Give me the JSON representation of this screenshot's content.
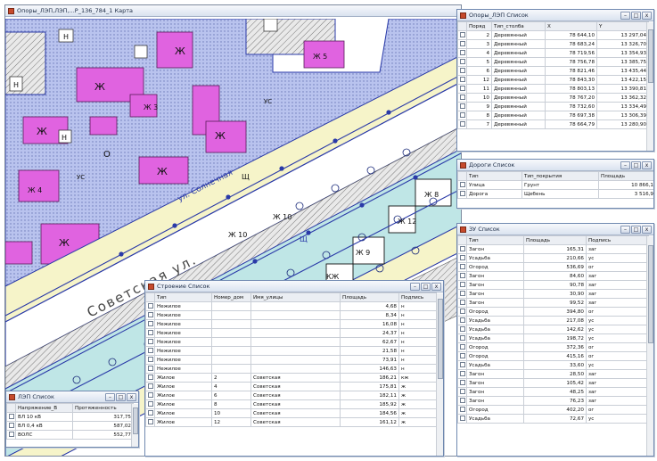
{
  "colors": {
    "building": "#e063e0",
    "parcel": "#b9c3ee",
    "green_strip": "#bfe6e6",
    "road": "#ffffff",
    "sidewalk": "#f6f4c9",
    "line": "#2a3aa8"
  },
  "map_window": {
    "title": "Опоры_ЛЭП,ЛЭП,...Р_136_784_1 Карта",
    "labels": {
      "street1": "ул. Солнечная",
      "street2": "Советская ул.",
      "sh1": "Щ",
      "sh2": "Щ",
      "g1": "Ж",
      "g2": "Ж",
      "g3": "Ж",
      "g4": "Ж",
      "g5": "Ж",
      "g6": "Ж",
      "n1": "Н",
      "n2": "Н",
      "n3": "Н",
      "us1": "УС",
      "us2": "УС",
      "z1": "Ж 9",
      "z2": "Ж 10",
      "z3": "Ж 10",
      "z4": "Ж 12",
      "z5": "Ж 8",
      "z6": "КЖ",
      "z7": "Ж 5",
      "z8": "Ж 3",
      "z9": "Ж 4",
      "g": "О"
    }
  },
  "poles_window": {
    "title": "Опоры_ЛЭП Список",
    "columns": [
      "Поряд",
      "Тип_столба",
      "X",
      "Y"
    ],
    "rows": [
      [
        "2",
        "Деревянный",
        "78 644,10",
        "13 297,04"
      ],
      [
        "3",
        "Деревянный",
        "78 683,24",
        "13 326,70"
      ],
      [
        "4",
        "Деревянный",
        "78 719,56",
        "13 354,93"
      ],
      [
        "5",
        "Деревянный",
        "78 756,78",
        "13 385,75"
      ],
      [
        "6",
        "Деревянный",
        "78 821,46",
        "13 435,44"
      ],
      [
        "12",
        "Деревянный",
        "78 843,30",
        "13 422,15"
      ],
      [
        "11",
        "Деревянный",
        "78 803,13",
        "13 390,81"
      ],
      [
        "10",
        "Деревянный",
        "78 767,20",
        "13 362,32"
      ],
      [
        "9",
        "Деревянный",
        "78 732,60",
        "13 334,49"
      ],
      [
        "8",
        "Деревянный",
        "78 697,38",
        "13 306,39"
      ],
      [
        "7",
        "Деревянный",
        "78 664,79",
        "13 280,90"
      ]
    ]
  },
  "roads_window": {
    "title": "Дороги Список",
    "columns": [
      "Тип",
      "Тип_покрытия",
      "Площадь"
    ],
    "rows": [
      [
        "Улица",
        "Грунт",
        "10 866,1"
      ],
      [
        "Дорога",
        "Щебень",
        "3 516,9"
      ]
    ]
  },
  "zu_window": {
    "title": "ЗУ Список",
    "columns": [
      "Тип",
      "Площадь",
      "Подпись"
    ],
    "rows": [
      [
        "Загон",
        "165,31",
        "заг"
      ],
      [
        "Усадьба",
        "210,66",
        "ус"
      ],
      [
        "Огород",
        "536,69",
        "ог"
      ],
      [
        "Загон",
        "84,60",
        "заг"
      ],
      [
        "Загон",
        "90,78",
        "заг"
      ],
      [
        "Загон",
        "30,90",
        "заг"
      ],
      [
        "Загон",
        "99,52",
        "заг"
      ],
      [
        "Огород",
        "394,80",
        "ог"
      ],
      [
        "Усадьба",
        "217,08",
        "ус"
      ],
      [
        "Усадьба",
        "142,62",
        "ус"
      ],
      [
        "Усадьба",
        "198,72",
        "ус"
      ],
      [
        "Огород",
        "372,36",
        "ог"
      ],
      [
        "Огород",
        "415,16",
        "ог"
      ],
      [
        "Усадьба",
        "33,60",
        "ус"
      ],
      [
        "Загон",
        "28,50",
        "заг"
      ],
      [
        "Загон",
        "105,42",
        "заг"
      ],
      [
        "Загон",
        "48,25",
        "заг"
      ],
      [
        "Загон",
        "76,23",
        "заг"
      ],
      [
        "Огород",
        "402,20",
        "ог"
      ],
      [
        "Усадьба",
        "72,67",
        "ус"
      ]
    ]
  },
  "buildings_window": {
    "title": "Строение Список",
    "columns": [
      "Тип",
      "Номер_дом",
      "Имя_улицы",
      "Площадь",
      "Подпись"
    ],
    "rows": [
      [
        "Нежилое",
        "",
        "",
        "4,68",
        "н"
      ],
      [
        "Нежилое",
        "",
        "",
        "8,34",
        "н"
      ],
      [
        "Нежилое",
        "",
        "",
        "16,08",
        "н"
      ],
      [
        "Нежилое",
        "",
        "",
        "24,37",
        "н"
      ],
      [
        "Нежилое",
        "",
        "",
        "62,67",
        "н"
      ],
      [
        "Нежилое",
        "",
        "",
        "21,58",
        "н"
      ],
      [
        "Нежилое",
        "",
        "",
        "73,91",
        "н"
      ],
      [
        "Нежилое",
        "",
        "",
        "146,63",
        "н"
      ],
      [
        "Жилое",
        "2",
        "Советская",
        "186,21",
        "кж"
      ],
      [
        "Жилое",
        "4",
        "Советская",
        "175,81",
        "ж"
      ],
      [
        "Жилое",
        "6",
        "Советская",
        "182,11",
        "ж"
      ],
      [
        "Жилое",
        "8",
        "Советская",
        "185,92",
        "ж"
      ],
      [
        "Жилое",
        "10",
        "Советская",
        "184,56",
        "ж"
      ],
      [
        "Жилое",
        "12",
        "Советская",
        "161,12",
        "ж"
      ]
    ]
  },
  "lep_window": {
    "title": "ЛЭП Список",
    "columns": [
      "Напряжение_В",
      "Протяженность"
    ],
    "rows": [
      [
        "ВЛ 10 кВ",
        "317,75"
      ],
      [
        "ВЛ 0,4 кВ",
        "587,02"
      ],
      [
        "ВОЛС",
        "552,77"
      ]
    ]
  },
  "titlebar_buttons": {
    "minimize": "–",
    "maximize": "□",
    "close": "x"
  }
}
